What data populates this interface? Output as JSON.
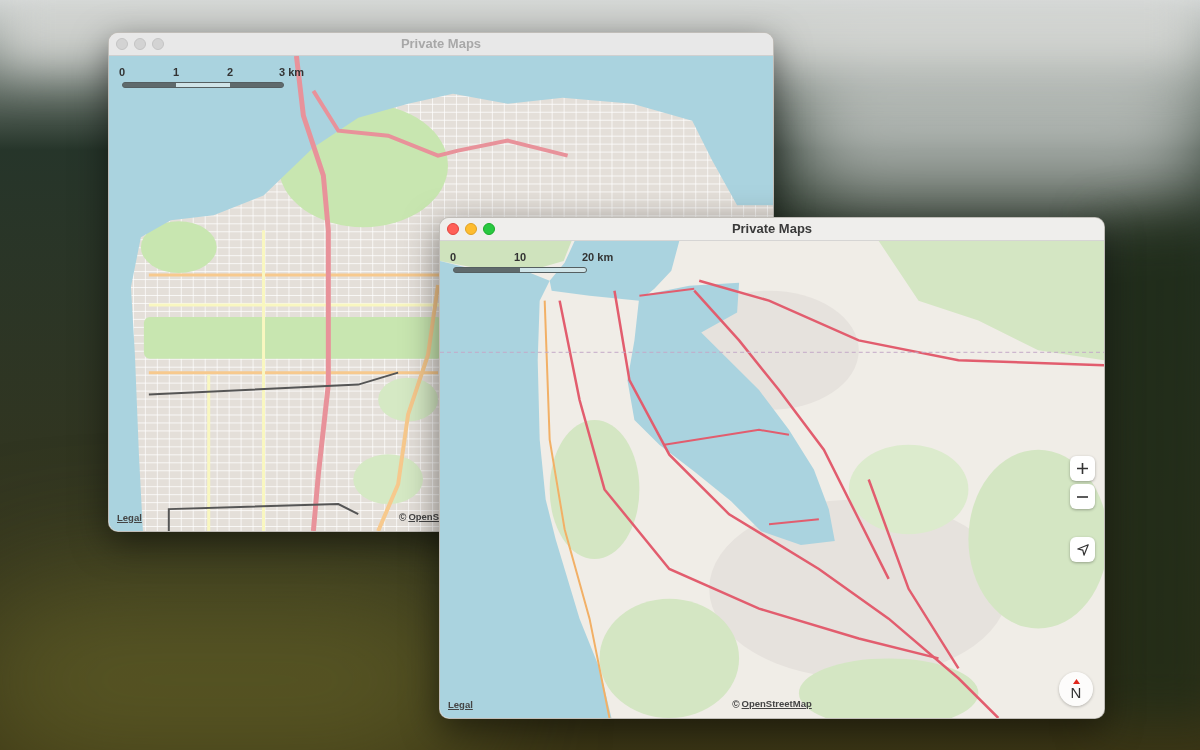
{
  "windows": [
    {
      "title": "Private Maps",
      "active": false,
      "scale_bar": [
        "0",
        "1",
        "2",
        "3 km"
      ],
      "legal": "Legal",
      "attribution": {
        "symbol": "©",
        "link": "OpenS"
      }
    },
    {
      "title": "Private Maps",
      "active": true,
      "scale_bar": [
        "0",
        "10",
        "20 km"
      ],
      "legal": "Legal",
      "attribution": {
        "symbol": "©",
        "link": "OpenStreetMap"
      },
      "compass": {
        "label": "N"
      }
    }
  ]
}
